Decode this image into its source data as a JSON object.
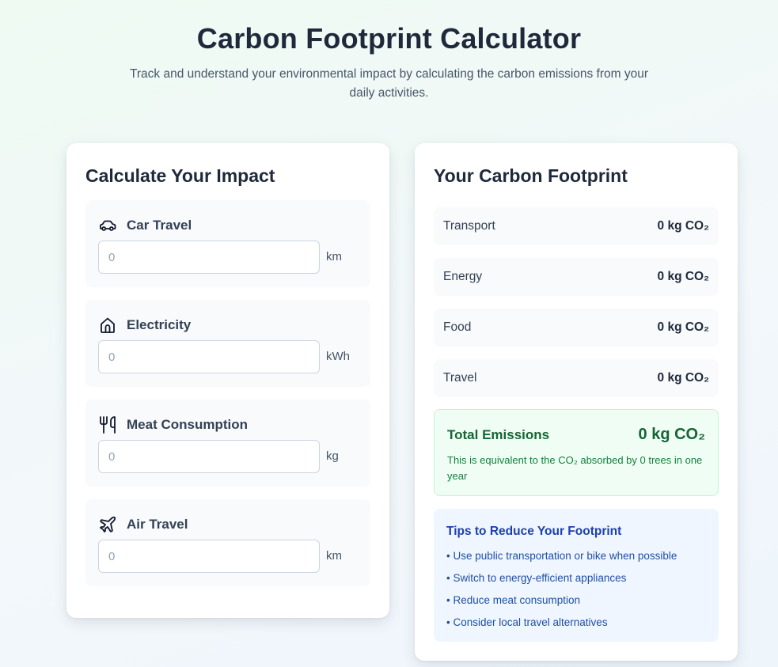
{
  "header": {
    "title": "Carbon Footprint Calculator",
    "subtitle": "Track and understand your environmental impact by calculating the carbon emissions from your daily activities."
  },
  "calculator": {
    "title": "Calculate Your Impact",
    "inputs": [
      {
        "label": "Car Travel",
        "icon": "car-icon",
        "placeholder": "0",
        "value": "",
        "unit": "km"
      },
      {
        "label": "Electricity",
        "icon": "home-icon",
        "placeholder": "0",
        "value": "",
        "unit": "kWh"
      },
      {
        "label": "Meat Consumption",
        "icon": "utensils-icon",
        "placeholder": "0",
        "value": "",
        "unit": "kg"
      },
      {
        "label": "Air Travel",
        "icon": "plane-icon",
        "placeholder": "0",
        "value": "",
        "unit": "km"
      }
    ]
  },
  "results": {
    "title": "Your Carbon Footprint",
    "rows": [
      {
        "label": "Transport",
        "value": "0 kg CO₂"
      },
      {
        "label": "Energy",
        "value": "0 kg CO₂"
      },
      {
        "label": "Food",
        "value": "0 kg CO₂"
      },
      {
        "label": "Travel",
        "value": "0 kg CO₂"
      }
    ],
    "total": {
      "label": "Total Emissions",
      "value": "0 kg CO₂",
      "note": "This is equivalent to the CO₂ absorbed by 0 trees in one year"
    },
    "tips": {
      "title": "Tips to Reduce Your Footprint",
      "items": [
        "• Use public transportation or bike when possible",
        "• Switch to energy-efficient appliances",
        "• Reduce meat consumption",
        "• Consider local travel alternatives"
      ]
    }
  },
  "colors": {
    "accent_green": "#166534",
    "total_background": "#f0fdf4",
    "tips_background": "#eff6ff",
    "tips_text": "#1e40af"
  }
}
